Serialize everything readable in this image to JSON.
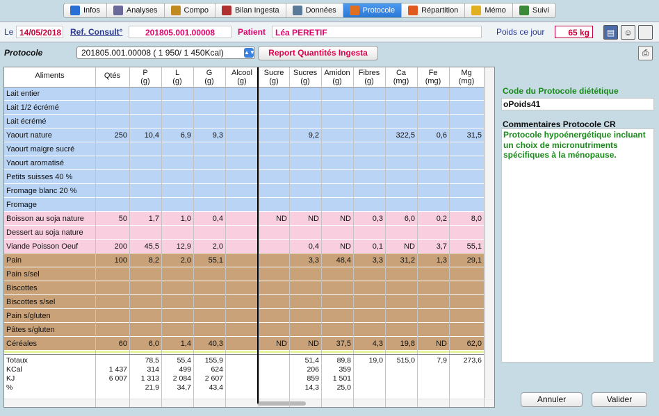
{
  "tabs": [
    {
      "label": "Infos",
      "icon": "info-icon",
      "color": "#2a6fd6",
      "active": false
    },
    {
      "label": "Analyses",
      "icon": "pen-icon",
      "color": "#6a6a9a",
      "active": false
    },
    {
      "label": "Compo",
      "icon": "scale-icon",
      "color": "#c08a20",
      "active": false
    },
    {
      "label": "Bilan Ingesta",
      "icon": "food-icon",
      "color": "#b03030",
      "active": false
    },
    {
      "label": "Données",
      "icon": "table-icon",
      "color": "#5a7a9a",
      "active": false
    },
    {
      "label": "Protocole",
      "icon": "protocol-icon",
      "color": "#e07020",
      "active": true
    },
    {
      "label": "Répartition",
      "icon": "clock-icon",
      "color": "#e05a20",
      "active": false
    },
    {
      "label": "Mémo",
      "icon": "folder-icon",
      "color": "#e0b020",
      "active": false
    },
    {
      "label": "Suivi",
      "icon": "checklist-icon",
      "color": "#3a8a3a",
      "active": false
    }
  ],
  "header": {
    "date_label": "Le",
    "date": "14/05/2018",
    "ref_label": "Ref. Consult°",
    "ref_value": "201805.001.00008",
    "patient_label": "Patient",
    "patient_value": "Léa PERETIF",
    "weight_label": "Poids ce jour",
    "weight_value": "65 kg"
  },
  "protocol": {
    "label": "Protocole",
    "selected": "201805.001.00008 ( 1 950/  1 450Kcal)",
    "report_button": "Report Quantités Ingesta"
  },
  "table": {
    "headers": [
      "Aliments",
      "Qtés",
      "P\n(g)",
      "L\n(g)",
      "G\n(g)",
      "Alcool\n(g)",
      "Sucre\n(g)",
      "Sucres\n(g)",
      "Amidon\n(g)",
      "Fibres\n(g)",
      "Ca\n(mg)",
      "Fe\n(mg)",
      "Mg\n(mg)"
    ],
    "rows": [
      {
        "group": "blue",
        "cells": [
          "Lait entier",
          "",
          "",
          "",
          "",
          "",
          "",
          "",
          "",
          "",
          "",
          "",
          ""
        ]
      },
      {
        "group": "blue",
        "cells": [
          "Lait 1/2 écrémé",
          "",
          "",
          "",
          "",
          "",
          "",
          "",
          "",
          "",
          "",
          "",
          ""
        ]
      },
      {
        "group": "blue",
        "cells": [
          "Lait écrémé",
          "",
          "",
          "",
          "",
          "",
          "",
          "",
          "",
          "",
          "",
          "",
          ""
        ]
      },
      {
        "group": "blue",
        "cells": [
          "Yaourt nature",
          "250",
          "10,4",
          "6,9",
          "9,3",
          "",
          "",
          "9,2",
          "",
          "",
          "322,5",
          "0,6",
          "31,5"
        ]
      },
      {
        "group": "blue",
        "cells": [
          "Yaourt maigre sucré",
          "",
          "",
          "",
          "",
          "",
          "",
          "",
          "",
          "",
          "",
          "",
          ""
        ]
      },
      {
        "group": "blue",
        "cells": [
          "Yaourt aromatisé",
          "",
          "",
          "",
          "",
          "",
          "",
          "",
          "",
          "",
          "",
          "",
          ""
        ]
      },
      {
        "group": "blue",
        "cells": [
          "Petits suisses 40 %",
          "",
          "",
          "",
          "",
          "",
          "",
          "",
          "",
          "",
          "",
          "",
          ""
        ]
      },
      {
        "group": "blue",
        "cells": [
          "Fromage blanc 20 %",
          "",
          "",
          "",
          "",
          "",
          "",
          "",
          "",
          "",
          "",
          "",
          ""
        ]
      },
      {
        "group": "blue",
        "cells": [
          "Fromage",
          "",
          "",
          "",
          "",
          "",
          "",
          "",
          "",
          "",
          "",
          "",
          ""
        ]
      },
      {
        "group": "pink",
        "cells": [
          "Boisson au soja nature",
          "50",
          "1,7",
          "1,0",
          "0,4",
          "",
          "ND",
          "ND",
          "ND",
          "0,3",
          "6,0",
          "0,2",
          "8,0"
        ]
      },
      {
        "group": "pink",
        "cells": [
          "Dessert au soja nature",
          "",
          "",
          "",
          "",
          "",
          "",
          "",
          "",
          "",
          "",
          "",
          ""
        ]
      },
      {
        "group": "pink",
        "cells": [
          "Viande Poisson Oeuf",
          "200",
          "45,5",
          "12,9",
          "2,0",
          "",
          "",
          "0,4",
          "ND",
          "0,1",
          "ND",
          "3,7",
          "55,1"
        ]
      },
      {
        "group": "brown",
        "cells": [
          "Pain",
          "100",
          "8,2",
          "2,0",
          "55,1",
          "",
          "",
          "3,3",
          "48,4",
          "3,3",
          "31,2",
          "1,3",
          "29,1"
        ]
      },
      {
        "group": "brown",
        "cells": [
          "Pain s/sel",
          "",
          "",
          "",
          "",
          "",
          "",
          "",
          "",
          "",
          "",
          "",
          ""
        ]
      },
      {
        "group": "brown",
        "cells": [
          "Biscottes",
          "",
          "",
          "",
          "",
          "",
          "",
          "",
          "",
          "",
          "",
          "",
          ""
        ]
      },
      {
        "group": "brown",
        "cells": [
          "Biscottes s/sel",
          "",
          "",
          "",
          "",
          "",
          "",
          "",
          "",
          "",
          "",
          "",
          ""
        ]
      },
      {
        "group": "brown",
        "cells": [
          "Pain s/gluten",
          "",
          "",
          "",
          "",
          "",
          "",
          "",
          "",
          "",
          "",
          "",
          ""
        ]
      },
      {
        "group": "brown",
        "cells": [
          "Pâtes s/gluten",
          "",
          "",
          "",
          "",
          "",
          "",
          "",
          "",
          "",
          "",
          "",
          ""
        ]
      },
      {
        "group": "brown",
        "cells": [
          "Céréales",
          "60",
          "6,0",
          "1,4",
          "40,3",
          "",
          "ND",
          "ND",
          "37,5",
          "4,3",
          "19,8",
          "ND",
          "62,0"
        ]
      }
    ],
    "totals": [
      [
        "Totaux",
        "",
        "78,5",
        "55,4",
        "155,9",
        "",
        "",
        "51,4",
        "89,8",
        "19,0",
        "515,0",
        "7,9",
        "273,6"
      ],
      [
        "KCal",
        "1 437",
        "314",
        "499",
        "624",
        "",
        "",
        "206",
        "359",
        "",
        "",
        "",
        ""
      ],
      [
        "KJ",
        "6 007",
        "1 313",
        "2 084",
        "2 607",
        "",
        "",
        "859",
        "1 501",
        "",
        "",
        "",
        ""
      ],
      [
        "%",
        "",
        "21,9",
        "34,7",
        "43,4",
        "",
        "",
        "14,3",
        "25,0",
        "",
        "",
        "",
        ""
      ]
    ]
  },
  "right_panel": {
    "code_label": "Code du Protocole diététique",
    "code_value": "oPoids41",
    "comments_label": "Commentaires Protocole CR",
    "comments_value": "Protocole hypoénergétique incluant un choix de micronutriments spécifiques à la ménopause."
  },
  "buttons": {
    "cancel": "Annuler",
    "validate": "Valider"
  },
  "colors": {
    "blue": "#b9d4f5",
    "pink": "#f9cfe0",
    "brown": "#c9a27a",
    "green_row": "#e4f59a"
  }
}
